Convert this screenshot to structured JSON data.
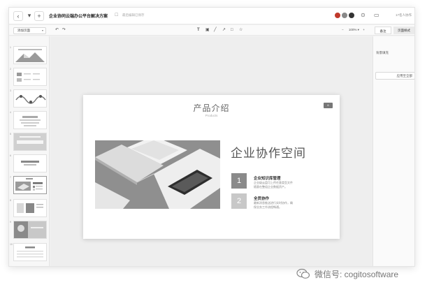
{
  "topbar": {
    "back": "‹",
    "menu": "▾",
    "add": "+",
    "title": "企业协同云端办公平台解决方案",
    "save_status": "最后编辑已保存",
    "collaborators": "17名人协作"
  },
  "toolbar": {
    "add_page": "添加页面",
    "undo": "↶",
    "redo": "↷",
    "zoom": "100% ▾",
    "zoom_out": "−",
    "zoom_in": "+"
  },
  "right_tabs": {
    "notes": "备注",
    "page_style": "页面样式"
  },
  "right_panel": {
    "background_label": "背景填充",
    "apply_all": "应用至全部"
  },
  "slide": {
    "title": "产品介绍",
    "subtitle": "Products",
    "badge": "6",
    "feature_title": "企业协作空间",
    "items": [
      {
        "num": "1",
        "title": "企业知识库管理",
        "desc": "企业级云盘可上传任意类型文件随意在整组企业数据资产。",
        "color": "#8a8a8a"
      },
      {
        "num": "2",
        "title": "全员协作",
        "desc": "最新消息推送进行实时协作，确保业务工作流程畅通。",
        "color": "#c8c8c8"
      }
    ]
  },
  "thumbnails": [
    "1",
    "2",
    "3",
    "4",
    "5",
    "6",
    "7",
    "8",
    "9",
    "10"
  ],
  "watermark": {
    "text": "微信号: cogitosoftware"
  }
}
